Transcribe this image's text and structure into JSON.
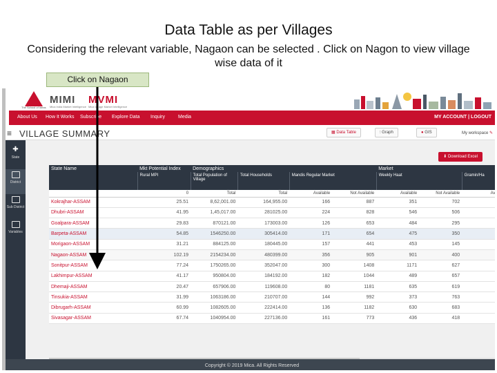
{
  "slide": {
    "title": "Data Table as per Villages",
    "subtitle": "Considering the relevant variable, Nagaon can be selected . Click on Nagon to view village wise data of it",
    "callout": "Click on Nagaon"
  },
  "brand": {
    "mica_tagline": "The School of Ideas",
    "logo1": "MIMI",
    "logo1_tag": "Mica India Market Intelligence",
    "logo2": "MVMI",
    "logo2_tag": "Mica Village Market Intelligence",
    "accent_color": "#c8102e"
  },
  "nav": {
    "items": [
      "About Us",
      "How It Works",
      "Subscribe",
      "Explore Data",
      "Inquiry",
      "Media"
    ],
    "account": "MY ACCOUNT | LOGOUT"
  },
  "village_summary": {
    "title": "VILLAGE SUMMARY",
    "data_table_btn": "Data Table",
    "graph_btn": "Graph",
    "gis_btn": "GIS",
    "workspace": "My workspace",
    "download_btn": "Download Excel"
  },
  "sidebar": {
    "items": [
      {
        "label": "State"
      },
      {
        "label": "District"
      },
      {
        "label": "Sub District"
      },
      {
        "label": "Variables"
      }
    ]
  },
  "table": {
    "group_headers": {
      "state_name": "State Name",
      "mpi": "Mkt Potential Index",
      "demographics": "Demographics",
      "market": "Market"
    },
    "sub_headers": {
      "rural_mpi": "Rural MPI",
      "total_pop": "Total Population of Village",
      "total_hh": "Total Households",
      "mandis": "Mandis Regular Market",
      "weekly_haat": "Weekly Haat",
      "gramin": "Gramin/Ha"
    },
    "value_headers": {
      "zero": "0",
      "total1": "Total",
      "total2": "Total",
      "available1": "Available",
      "not_available1": "Not Available",
      "available2": "Available",
      "not_available2": "Not Available",
      "av": "Av"
    },
    "rows": [
      {
        "name": "Kokrajhar-ASSAM",
        "mpi": "25.51",
        "pop": "8,62,001.00",
        "hh": "164,955.00",
        "a1": "166",
        "n1": "887",
        "a2": "351",
        "n2": "702"
      },
      {
        "name": "Dhubri-ASSAM",
        "mpi": "41.95",
        "pop": "1,45,017.00",
        "hh": "281025.00",
        "a1": "224",
        "n1": "828",
        "a2": "546",
        "n2": "506"
      },
      {
        "name": "Goalpara-ASSAM",
        "mpi": "29.83",
        "pop": "870121.00",
        "hh": "173003.00",
        "a1": "126",
        "n1": "653",
        "a2": "484",
        "n2": "295"
      },
      {
        "name": "Barpeta-ASSAM",
        "mpi": "54.85",
        "pop": "1546250.00",
        "hh": "305414.00",
        "a1": "171",
        "n1": "654",
        "a2": "475",
        "n2": "350"
      },
      {
        "name": "Morigaon-ASSAM",
        "mpi": "31.21",
        "pop": "884125.00",
        "hh": "180445.00",
        "a1": "157",
        "n1": "441",
        "a2": "453",
        "n2": "145"
      },
      {
        "name": "Nagaon-ASSAM",
        "mpi": "102.19",
        "pop": "2154234.00",
        "hh": "480399.00",
        "a1": "356",
        "n1": "905",
        "a2": "901",
        "n2": "400"
      },
      {
        "name": "Sonitpur-ASSAM",
        "mpi": "77.24",
        "pop": "1750265.00",
        "hh": "352047.00",
        "a1": "300",
        "n1": "1408",
        "a2": "1171",
        "n2": "627"
      },
      {
        "name": "Lakhimpur-ASSAM",
        "mpi": "41.17",
        "pop": "950804.00",
        "hh": "184192.00",
        "a1": "182",
        "n1": "1044",
        "a2": "489",
        "n2": "657"
      },
      {
        "name": "Dhemaji-ASSAM",
        "mpi": "20.47",
        "pop": "657906.00",
        "hh": "119608.00",
        "a1": "80",
        "n1": "1181",
        "a2": "635",
        "n2": "619"
      },
      {
        "name": "Tinsukia-ASSAM",
        "mpi": "31.99",
        "pop": "1063186.00",
        "hh": "210707.00",
        "a1": "144",
        "n1": "992",
        "a2": "373",
        "n2": "763"
      },
      {
        "name": "Dibrugarh-ASSAM",
        "mpi": "60.99",
        "pop": "1082605.00",
        "hh": "222414.00",
        "a1": "136",
        "n1": "1182",
        "a2": "630",
        "n2": "683"
      },
      {
        "name": "Sivasagar-ASSAM",
        "mpi": "67.74",
        "pop": "1040954.00",
        "hh": "227136.00",
        "a1": "161",
        "n1": "773",
        "a2": "436",
        "n2": "418"
      }
    ]
  },
  "footer": {
    "text": "Copyright © 2019 Mica. All Rights Reserved"
  }
}
